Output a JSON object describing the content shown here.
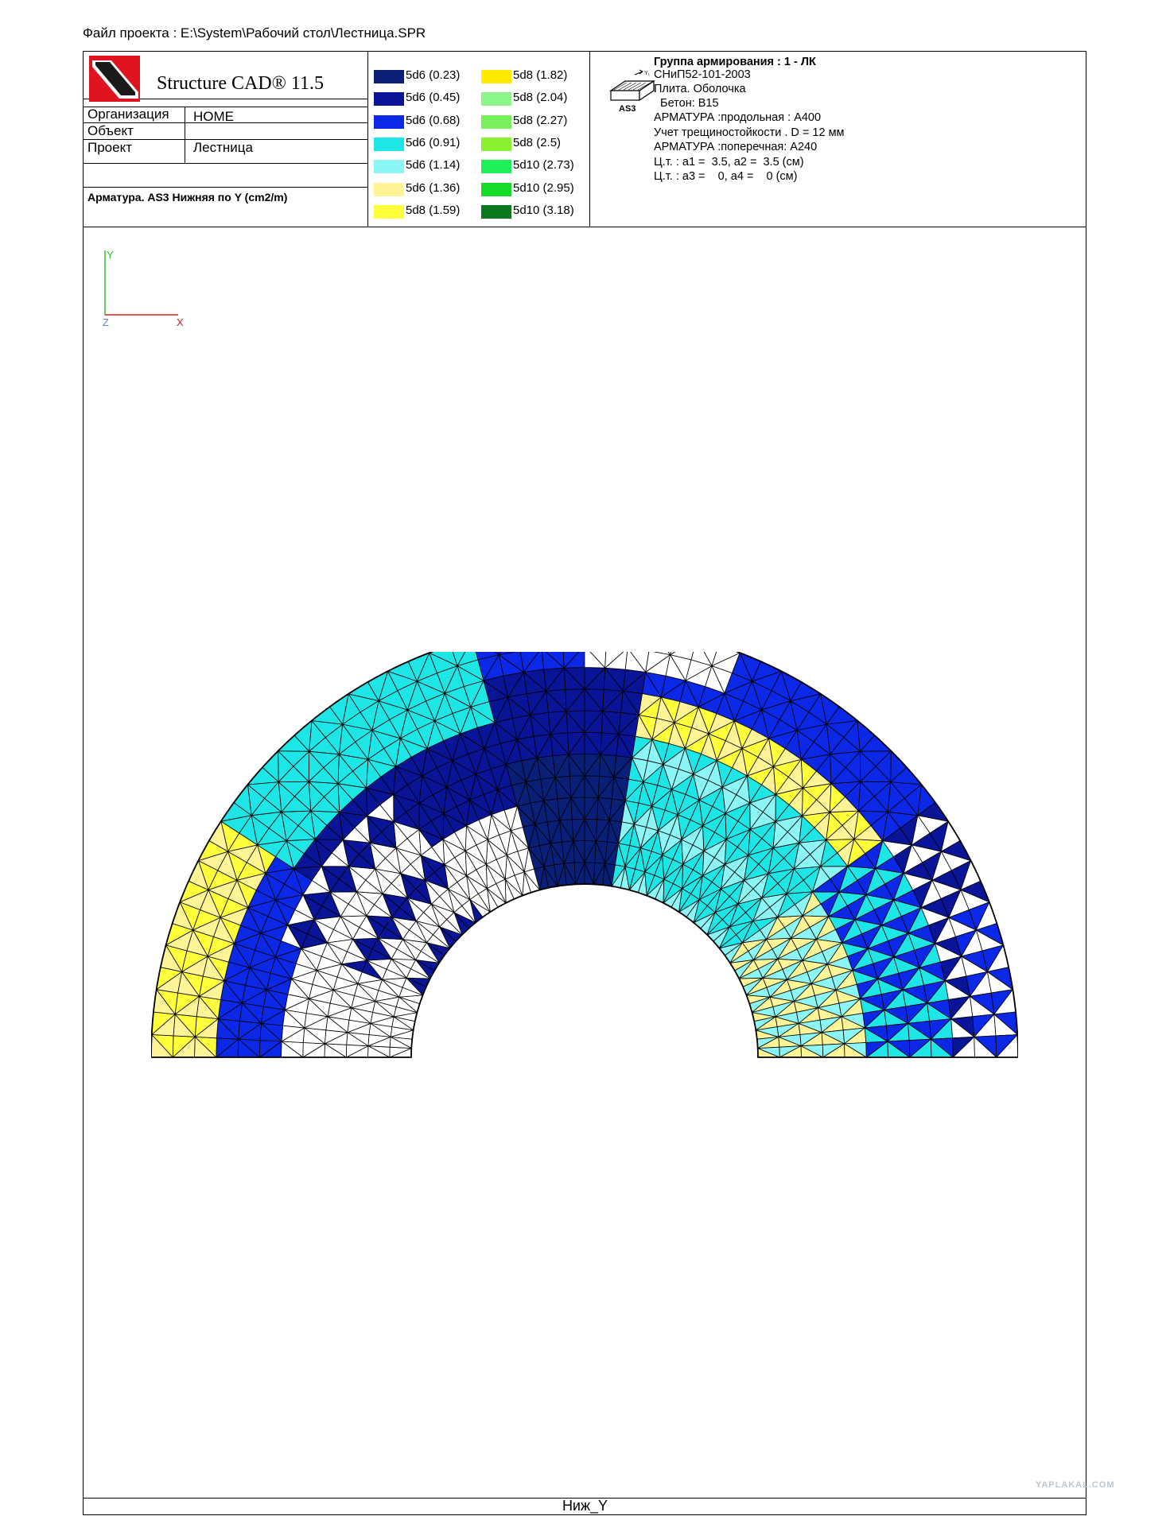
{
  "header": {
    "file_line": "Файл проекта : E:\\System\\Рабочий стол\\Лестница.SPR",
    "app_title": "Structure CAD® 11.5",
    "info": [
      {
        "label": "Организация",
        "value": "HOME"
      },
      {
        "label": "Объект",
        "value": ""
      },
      {
        "label": "Проект",
        "value": "Лестница"
      }
    ],
    "drawing_title": "Арматура. AS3 Нижняя по Y (cm2/m)"
  },
  "legend": {
    "items": [
      {
        "label": "5d6 (0.23)",
        "color": "#0a1f78"
      },
      {
        "label": "5d6 (0.45)",
        "color": "#0a1496"
      },
      {
        "label": "5d6 (0.68)",
        "color": "#0a28e6"
      },
      {
        "label": "5d6 (0.91)",
        "color": "#1ee6e6"
      },
      {
        "label": "5d6 (1.14)",
        "color": "#8cf5f5"
      },
      {
        "label": "5d6 (1.36)",
        "color": "#fff596"
      },
      {
        "label": "5d8 (1.59)",
        "color": "#ffff3c"
      },
      {
        "label": "5d8 (1.82)",
        "color": "#ffeb00"
      },
      {
        "label": "5d8 (2.04)",
        "color": "#8cf58c"
      },
      {
        "label": "5d8 (2.27)",
        "color": "#78f05a"
      },
      {
        "label": "5d8 (2.5)",
        "color": "#8cf032"
      },
      {
        "label": "5d10 (2.73)",
        "color": "#1ef05a"
      },
      {
        "label": "5d10 (2.95)",
        "color": "#14dc28"
      },
      {
        "label": "5d10 (3.18)",
        "color": "#0a781e"
      }
    ]
  },
  "params": {
    "icon_label": "AS3",
    "lines": [
      "Группа армирования  : 1 - ЛК",
      "СНиП52-101-2003",
      "Плита. Оболочка",
      "  Бетон: B15",
      "АРМАТУРА :продольная : A400",
      "Учет трещиностойкости . D = 12 мм",
      "АРМАТУРА :поперечная: A240",
      "Ц.т. : a1 =  3.5, a2 =  3.5 (см)",
      "Ц.т. : a3 =    0, a4 =    0 (см)"
    ]
  },
  "axes": {
    "y": "Y",
    "z": "Z",
    "x": "X",
    "y_color": "#28c828",
    "x_color": "#dc1e1e"
  },
  "footer": {
    "label": "Ниж_Y"
  },
  "watermark": "YAPLAKAL.COM"
}
